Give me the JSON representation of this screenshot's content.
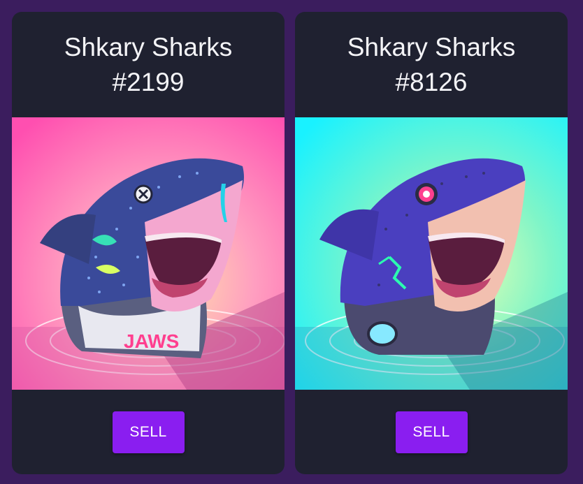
{
  "cards": [
    {
      "name": "Shkary Sharks",
      "number": "#2199",
      "sell_label": "SELL",
      "art": {
        "bg_top": "#ff5fb4",
        "bg_mid": "#ff9fc0",
        "bg_glow": "#ffe7a8",
        "shark": "#3a4a9a",
        "accent": "#ff3f8f"
      },
      "shirt_text": "JAWS"
    },
    {
      "name": "Shkary Sharks",
      "number": "#8126",
      "sell_label": "SELL",
      "art": {
        "bg_top": "#19f2ff",
        "bg_mid": "#4cf5d6",
        "bg_glow": "#eaffb0",
        "shark": "#4a3fbf",
        "accent": "#ff3f8f"
      },
      "shirt_text": ""
    }
  ]
}
